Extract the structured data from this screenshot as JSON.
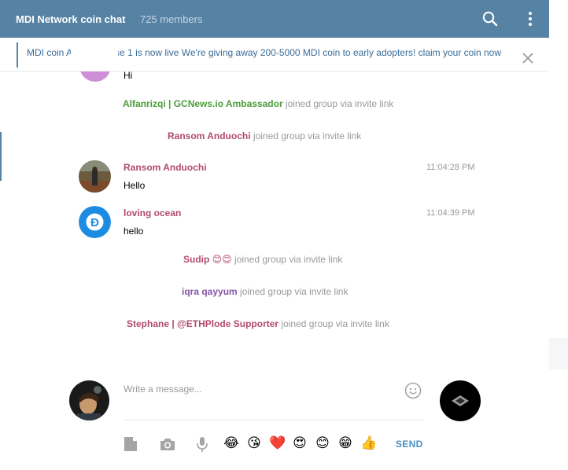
{
  "header": {
    "title": "MDI Network coin chat",
    "members": "725 members",
    "bg_color": "#5682a3"
  },
  "pinned": {
    "text": "MDI coin Airdrop phase 1 is now live We're giving away 200-5000 MDI coin to early adopters! claim your coin now"
  },
  "messages": {
    "partial_text": "Hi",
    "svc1": {
      "name": "Alfanrizqi | GCNews.io Ambassador",
      "action": " joined group via invite link"
    },
    "svc2": {
      "name": "Ransom Anduochi",
      "action": " joined group via invite link"
    },
    "msg1": {
      "author": "Ransom Anduochi",
      "time": "11:04:28 PM",
      "text": "Hello"
    },
    "msg2": {
      "author": "loving ocean",
      "time": "11:04:39 PM",
      "text": "hello"
    },
    "svc3": {
      "name": "Sudip 😊😊",
      "action": " joined group via invite link"
    },
    "svc4": {
      "name": "iqra qayyum",
      "action": " joined group via invite link"
    },
    "svc5": {
      "name": "Stephane | @ETHPlode Supporter",
      "action": " joined group via invite link"
    }
  },
  "composer": {
    "placeholder": "Write a message...",
    "send_label": "SEND",
    "emoji_shortcuts": [
      "😂",
      "😘",
      "❤️",
      "😍",
      "😊",
      "😁",
      "👍"
    ]
  },
  "icons": [
    "search-icon",
    "more-vertical-icon",
    "close-icon",
    "smile-icon",
    "document-icon",
    "camera-icon",
    "microphone-icon"
  ]
}
